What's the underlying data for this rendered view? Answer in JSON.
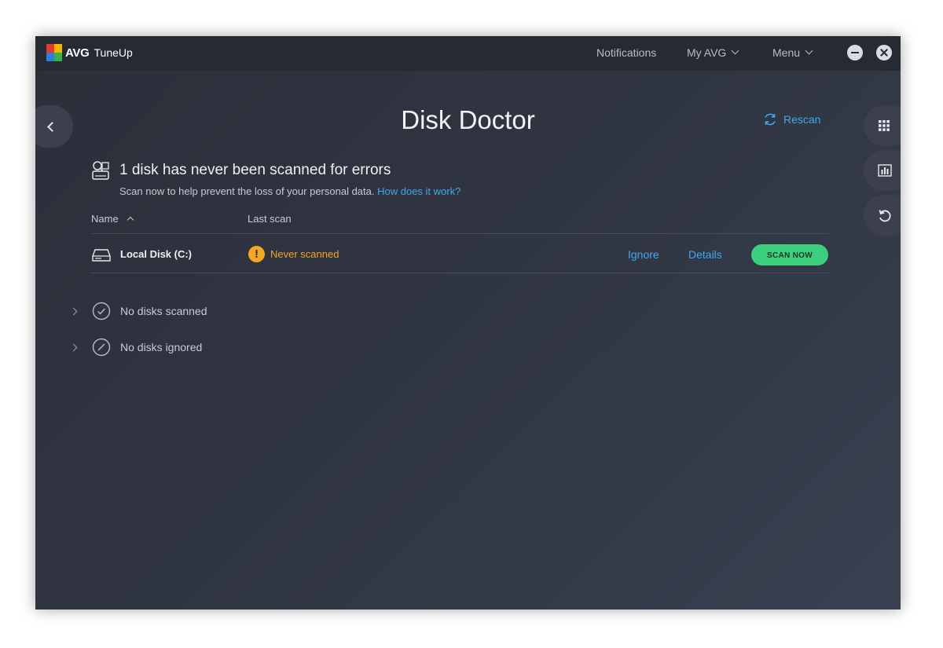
{
  "titlebar": {
    "brand": "AVG",
    "product": "TuneUp",
    "nav": {
      "notifications": "Notifications",
      "my_avg": "My AVG",
      "menu": "Menu"
    }
  },
  "page": {
    "title": "Disk Doctor",
    "rescan_label": "Rescan"
  },
  "alert": {
    "title": "1 disk has never been scanned for errors",
    "subtitle": "Scan now to help prevent the loss of your personal data.",
    "link": "How does it work?"
  },
  "table": {
    "columns": {
      "name": "Name",
      "last_scan": "Last scan"
    },
    "rows": [
      {
        "name": "Local Disk (C:)",
        "status": "Never scanned",
        "ignore": "Ignore",
        "details": "Details",
        "action": "SCAN NOW"
      }
    ]
  },
  "groups": [
    {
      "label": "No disks scanned"
    },
    {
      "label": "No disks ignored"
    }
  ],
  "icons": {
    "back": "chevron-left-icon",
    "rescan": "refresh-icon",
    "apps": "grid-icon",
    "stats": "bar-chart-icon",
    "undo": "undo-icon",
    "warning": "exclamation-icon"
  },
  "colors": {
    "accent": "#3ea9ef",
    "warning": "#f5a623",
    "primary_button": "#3ccf7d",
    "background": "#2e323d"
  },
  "warning_glyph": "!"
}
